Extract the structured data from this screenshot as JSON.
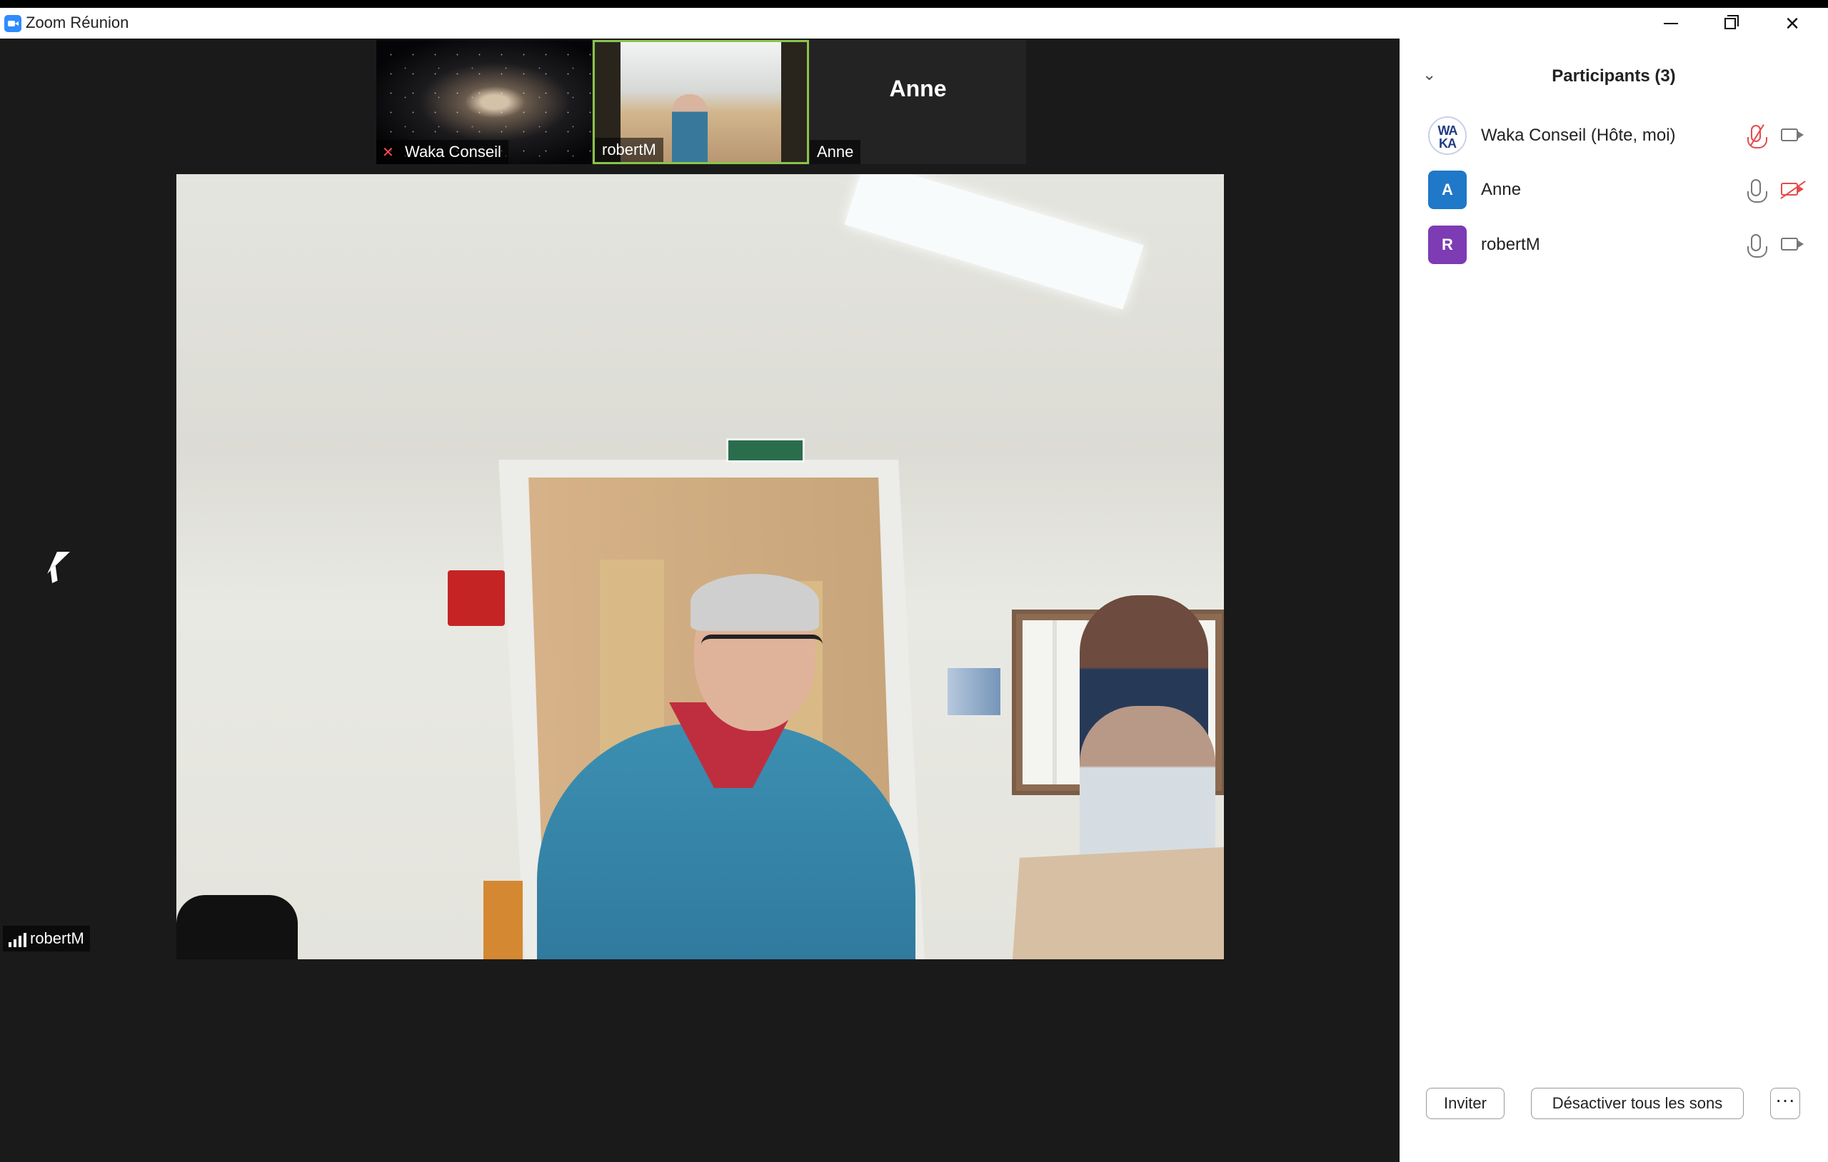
{
  "window": {
    "title": "Zoom Réunion",
    "controls": {
      "minimize": "minimize-icon",
      "restore": "restore-icon",
      "close": "close-icon"
    }
  },
  "thumbnails": [
    {
      "name": "Waka Conseil",
      "muted": true
    },
    {
      "name": "robertM",
      "active_speaker": true
    },
    {
      "name": "Anne",
      "display_name": "Anne"
    }
  ],
  "main_video": {
    "speaker_label": "robertM"
  },
  "participants_panel": {
    "title": "Participants (3)",
    "participants": [
      {
        "avatar_text": "WA KA",
        "name": "Waka Conseil (Hôte, moi)",
        "mic": "muted",
        "camera": "on"
      },
      {
        "avatar_text": "A",
        "name": "Anne",
        "mic": "on",
        "camera": "muted"
      },
      {
        "avatar_text": "R",
        "name": "robertM",
        "mic": "on",
        "camera": "on"
      }
    ],
    "buttons": {
      "invite": "Inviter",
      "mute_all": "Désactiver tous les sons",
      "more": "···"
    }
  },
  "colors": {
    "active_border": "#8bc34a",
    "muted": "#e54b4b",
    "anne_avatar": "#1f78c8",
    "robert_avatar": "#7d3bb4"
  }
}
